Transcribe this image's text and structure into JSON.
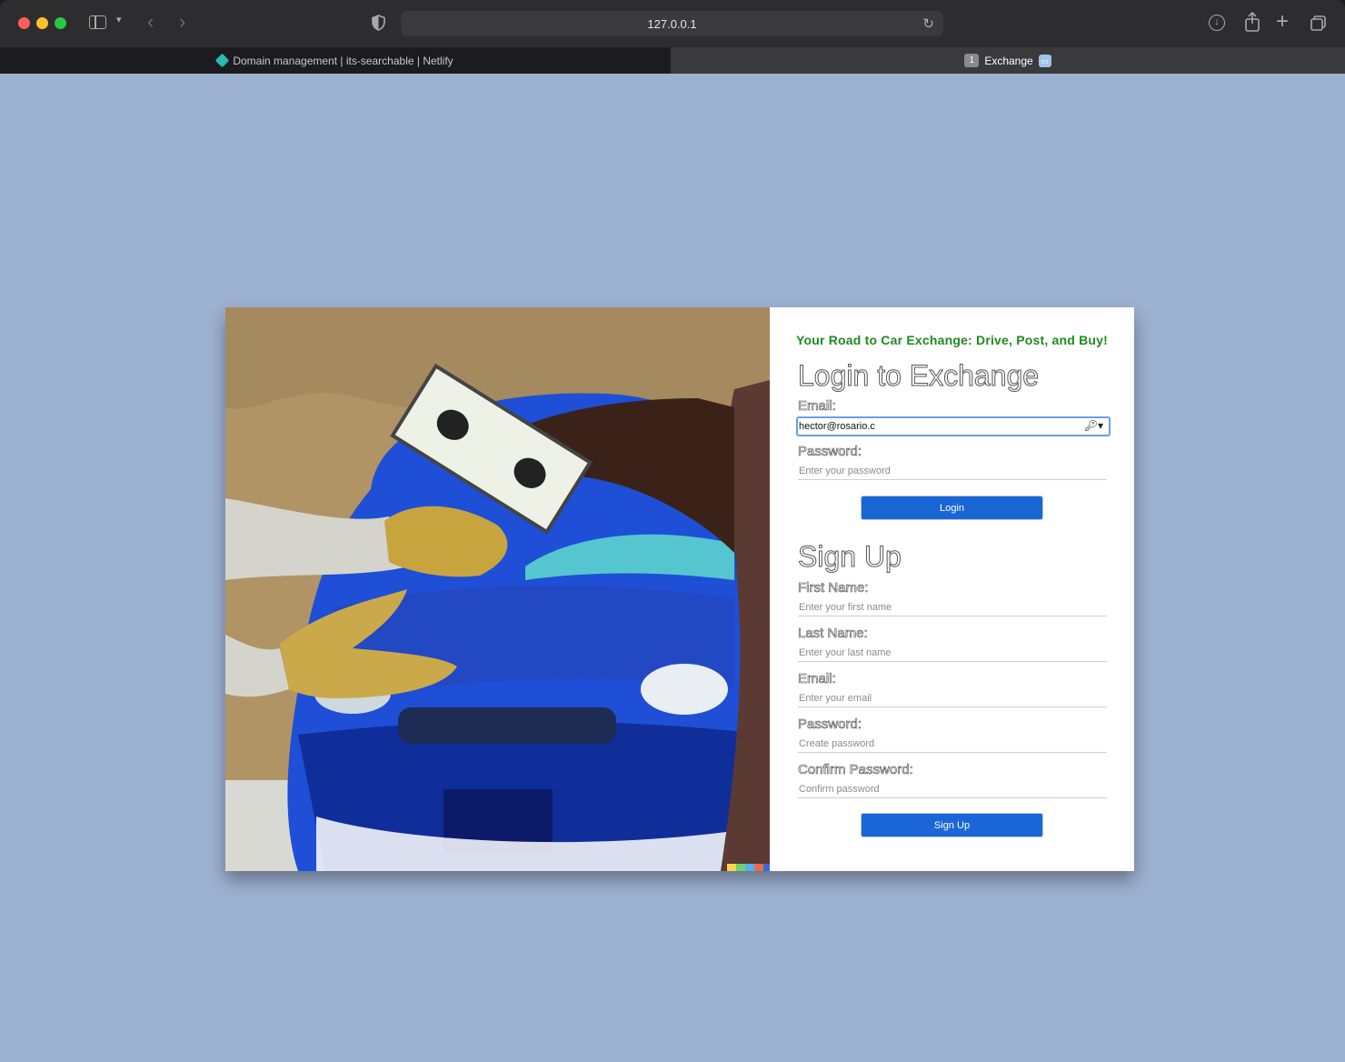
{
  "browser": {
    "url": "127.0.0.1",
    "tabs": [
      {
        "label": "Domain management | its-searchable | Netlify",
        "active": false
      },
      {
        "label": "Exchange",
        "active": true,
        "count": "1"
      }
    ]
  },
  "page": {
    "tagline": "Your Road to Car Exchange: Drive, Post, and Buy!",
    "login": {
      "title": "Login to Exchange",
      "email_label": "Email:",
      "email_value": "hector@rosario.c",
      "password_label": "Password:",
      "password_placeholder": "Enter your password",
      "button": "Login"
    },
    "signup": {
      "title": "Sign Up",
      "first_name_label": "First Name:",
      "first_name_placeholder": "Enter your first name",
      "last_name_label": "Last Name:",
      "last_name_placeholder": "Enter your last name",
      "email_label": "Email:",
      "email_placeholder": "Enter your email",
      "password_label": "Password:",
      "password_placeholder": "Create password",
      "confirm_label": "Confirm Password:",
      "confirm_placeholder": "Confirm password",
      "button": "Sign Up"
    }
  },
  "colors": {
    "page_background": "#9db1d1",
    "tagline": "#1f8a1f",
    "button": "#1a66d6",
    "car": "#1f4fd6"
  }
}
